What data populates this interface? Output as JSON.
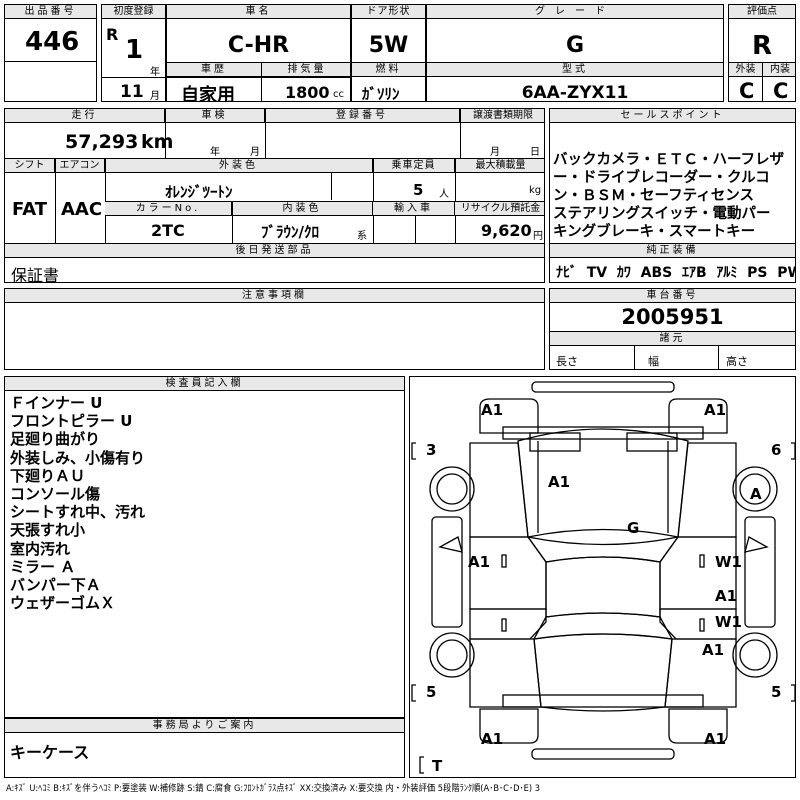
{
  "header": {
    "lot_no_label": "出品番号",
    "lot_no": "446",
    "reg_label": "初度登録",
    "reg_era": "R",
    "reg_year": "1",
    "year_unit": "年",
    "reg_month": "11",
    "month_unit": "月",
    "car_name_label": "車名",
    "car_name": "C-HR",
    "history_label": "車歴",
    "history": "自家用",
    "displacement_label": "排気量",
    "displacement": "1800",
    "displacement_unit": "cc",
    "door_label": "ドア形状",
    "door": "5W",
    "fuel_label": "燃料",
    "fuel": "ｶﾞｿﾘﾝ",
    "grade_label": "グレード",
    "grade": "G",
    "model_label": "型式",
    "model": "6AA-ZYX11",
    "score_label": "評価点",
    "score": "R",
    "exterior_label": "外装",
    "exterior": "C",
    "interior_label": "内装",
    "interior": "C"
  },
  "row2": {
    "mileage_label": "走行",
    "mileage": "57,293",
    "mileage_unit": "km",
    "inspection_label": "車検",
    "insp_year_unit": "年",
    "insp_month_unit": "月",
    "reg_no_label": "登録番号",
    "transfer_label": "譲渡書類期限",
    "transfer_month_unit": "月",
    "transfer_day_unit": "日",
    "shift_label": "シフト",
    "shift": "FAT",
    "ac_label": "エアコン",
    "ac": "AAC",
    "color_label": "外装色",
    "color": "ｵﾚﾝｼﾞﾂｰﾄﾝ",
    "capacity_label": "乗車定員",
    "capacity": "5",
    "capacity_unit": "人",
    "load_label": "最大積載量",
    "load_unit": "kg",
    "color_no_label": "カラーNo.",
    "color_no": "2TC",
    "interior_color_label": "内装色",
    "interior_color": "ﾌﾞﾗｳﾝ/ｸﾛ",
    "interior_color_unit": "系",
    "import_label": "輸入車",
    "recycle_label": "リサイクル預託金",
    "recycle": "9,620",
    "recycle_unit": "円",
    "deferred_label": "後日発送部品",
    "deferred": "保証書"
  },
  "sales": {
    "label": "セールスポイント",
    "lines": [
      "バックカメラ・ＥＴＣ・ハーフレザ",
      "ー・ドライブレコーダー・クルコ",
      "ン・ＢＳＭ・セーフティセンス",
      "ステアリングスイッチ・電動パー",
      "キングブレーキ・スマートキー"
    ],
    "equip_label": "純正装備",
    "equip": [
      "ﾅﾋﾞ",
      "TV",
      "ｶﾜ",
      "ABS",
      "ｴｱB",
      "ｱﾙﾐ",
      "PS",
      "PW"
    ]
  },
  "notes": {
    "label": "注意事項欄"
  },
  "chassis": {
    "label": "車台番号",
    "number": "2005951",
    "specs_label": "諸元",
    "length_label": "長さ",
    "width_label": "幅",
    "height_label": "高さ"
  },
  "inspector": {
    "label": "検査員記入欄",
    "lines": [
      "Ｆインナー U",
      "フロントピラー U",
      "足廻り曲がり",
      "外装しみ、小傷有り",
      "下廻りＡＵ",
      "コンソール傷",
      "シートすれ中、汚れ",
      "天張すれ小",
      "室内汚れ",
      "ミラー Ａ",
      "バンパー下Ａ",
      "ウェザーゴムＸ"
    ]
  },
  "office": {
    "label": "事務局よりご案内",
    "text": "キーケース"
  },
  "diagram": {
    "marks": {
      "front_left": "A1",
      "front_right": "A1",
      "tire_left_front": "3",
      "tire_right_front": "6",
      "hood": "A1",
      "right_front_wheel": "A",
      "roof": "G",
      "left_door": "A1",
      "right_front_door": "W1",
      "right_rear_door_a": "A1",
      "right_rear_door_w": "W1",
      "right_rear_wheel": "A1",
      "tire_left_rear": "5",
      "tire_right_rear": "5",
      "rear_left": "A1",
      "rear_right": "A1",
      "trunk": "T"
    }
  },
  "legend": "A:ｷｽﾞ  U:ﾍｺﾐ  B:ｷｽﾞを伴うﾍｺﾐ  P:要塗装  W:補修跡  S:錆  C:腐食  G:ﾌﾛﾝﾄｶﾞﾗｽ点ｷｽﾞ  XX:交換済み  X:要交換   内・外装評価  5段階ﾗﾝｸ順(A･B･C･D･E) 3"
}
